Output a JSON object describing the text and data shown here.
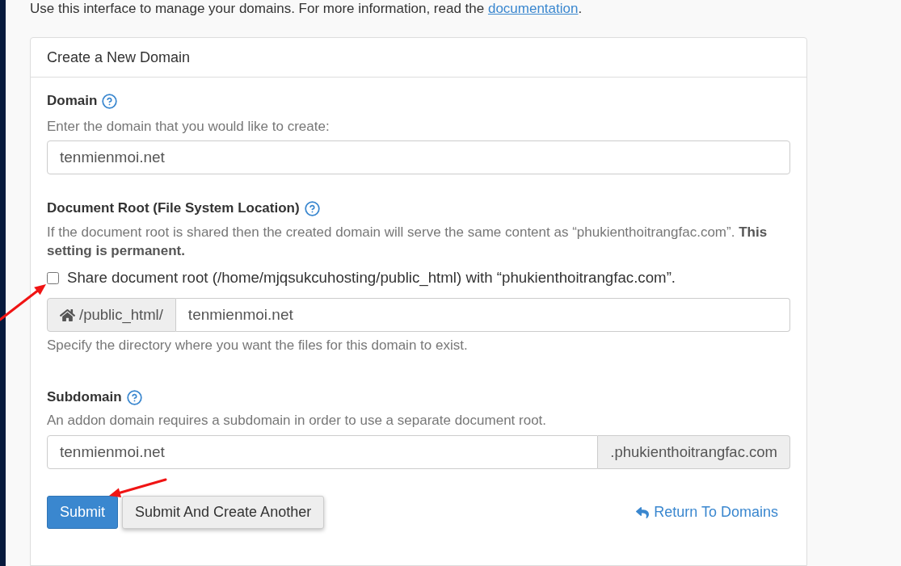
{
  "intro": {
    "text": "Use this interface to manage your domains. For more information, read the ",
    "link": "documentation",
    "after": "."
  },
  "panel": {
    "title": "Create a New Domain"
  },
  "fields": [
    {
      "kind": "text",
      "label": "Domain",
      "hint": "Enter the domain that you would like to create:",
      "value": "tenmienmoi.net"
    },
    {
      "kind": "docroot",
      "label": "Document Root (File System Location)",
      "hint": "If the document root is shared then the created domain will serve the same content as “phukienthoitrangfac.com”. **This setting is permanent.**",
      "checkbox": {
        "label": "Share document root (/home/mjqsukcuhosting/public_html) with “phukienthoitrangfac.com”.",
        "checked": false
      },
      "prefix": "/public_html/",
      "value": "tenmienmoi.net",
      "help": "Specify the directory where you want the files for this domain to exist."
    },
    {
      "kind": "subdomain",
      "label": "Subdomain",
      "hint": "An addon domain requires a subdomain in order to use a separate document root.",
      "value": "tenmienmoi.net",
      "suffix": ".phukienthoitrangfac.com"
    }
  ],
  "buttons": [
    {
      "label": "Submit",
      "kind": "primary"
    },
    {
      "label": "Submit And Create Another",
      "kind": "default"
    }
  ],
  "return_link": {
    "label": "Return To Domains"
  }
}
